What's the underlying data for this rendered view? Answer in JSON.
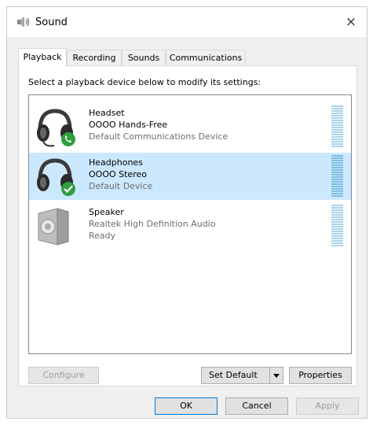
{
  "window": {
    "title": "Sound",
    "close_glyph": "×"
  },
  "tabs": [
    {
      "label": "Playback"
    },
    {
      "label": "Recording"
    },
    {
      "label": "Sounds"
    },
    {
      "label": "Communications"
    }
  ],
  "instruction": "Select a playback device below to modify its settings:",
  "devices": [
    {
      "name": "Headset",
      "detail": "OOOO Hands-Free",
      "status": "Default Communications Device",
      "icon": "headset-icon",
      "badge": "phone-badge-icon"
    },
    {
      "name": "Headphones",
      "detail": "OOOO Stereo",
      "status": "Default Device",
      "icon": "headphones-icon",
      "badge": "check-badge-icon",
      "selected": true
    },
    {
      "name": "Speaker",
      "detail": "Realtek High Definition Audio",
      "status": "Ready",
      "icon": "speaker-icon"
    }
  ],
  "buttons": {
    "configure": "Configure",
    "set_default": "Set Default",
    "properties": "Properties",
    "ok": "OK",
    "cancel": "Cancel",
    "apply": "Apply"
  },
  "colors": {
    "selection": "#cce8ff",
    "accent": "#0078d7",
    "badge_green": "#2e9e3e"
  }
}
